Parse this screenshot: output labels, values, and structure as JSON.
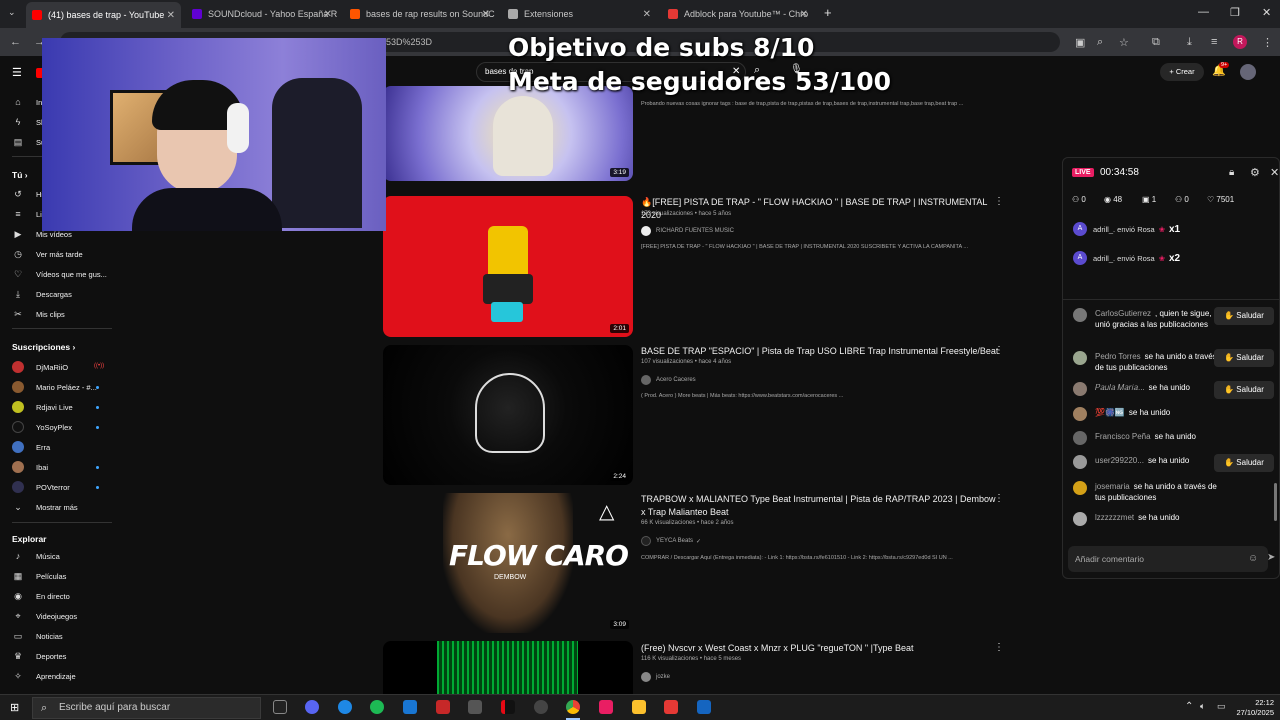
{
  "browser": {
    "tabs": [
      {
        "label": "(41) bases de trap - YouTube",
        "color": "#ff0000"
      },
      {
        "label": "SOUNDcloud - Yahoo España R",
        "color": "#6001d2"
      },
      {
        "label": "bases de rap results on SoundC",
        "color": "#ff5500"
      },
      {
        "label": "Extensiones",
        "color": "#aaaaaa"
      },
      {
        "label": "Adblock para Youtube™ - Chro",
        "color": "#e53935"
      }
    ],
    "url_fragment": "53D%253D",
    "profile_letter": "R"
  },
  "overlay": {
    "subs_goal": "Objetivo de subs 8/10",
    "followers_goal": "Meta de seguidores 53/100"
  },
  "youtube": {
    "search_value": "bases de trap",
    "create_label": "Crear",
    "notif_badge": "9+",
    "sidebar": {
      "you_heading": "Tú",
      "you_items": [
        {
          "icon": "history-icon",
          "label": "Historial"
        },
        {
          "icon": "playlist-icon",
          "label": "Listas"
        },
        {
          "icon": "video-icon",
          "label": "Mis vídeos"
        },
        {
          "icon": "clock-icon",
          "label": "Ver más tarde"
        },
        {
          "icon": "like-icon",
          "label": "Vídeos que me gus..."
        },
        {
          "icon": "download-icon",
          "label": "Descargas"
        },
        {
          "icon": "scissors-icon",
          "label": "Mis clips"
        }
      ],
      "subs_heading": "Suscripciones",
      "subscriptions": [
        {
          "label": "DjMaRiiO",
          "color": "#c03030",
          "live": true
        },
        {
          "label": "Mario Peláez - #...",
          "color": "#8a5a30",
          "dot": true
        },
        {
          "label": "Rdjavi Live",
          "color": "#c0c020",
          "dot": true
        },
        {
          "label": "YoSoyPlex",
          "color": "#111111",
          "dot": true
        },
        {
          "label": "Erra",
          "color": "#4070c0",
          "dot": false
        },
        {
          "label": "Ibai",
          "color": "#a07050",
          "dot": true
        },
        {
          "label": "POVterror",
          "color": "#303050",
          "dot": true
        }
      ],
      "show_more": "Mostrar más",
      "explore_heading": "Explorar",
      "explore_items": [
        {
          "icon": "music-icon",
          "label": "Música"
        },
        {
          "icon": "film-icon",
          "label": "Películas"
        },
        {
          "icon": "live-icon",
          "label": "En directo"
        },
        {
          "icon": "gamepad-icon",
          "label": "Videojuegos"
        },
        {
          "icon": "news-icon",
          "label": "Noticias"
        },
        {
          "icon": "trophy-icon",
          "label": "Deportes"
        },
        {
          "icon": "bulb-icon",
          "label": "Aprendizaje"
        }
      ]
    },
    "results": [
      {
        "duration": "3:19",
        "desc": "Probando nuevas cosas ignorar tags : base de trap,pista de trap,pistas de trap,bases de trap,instrumental trap,base trap,beat trap ..."
      },
      {
        "title": "🔥[FREE] PISTA DE TRAP - \" FLOW HACKIAO \" | BASE DE TRAP | INSTRUMENTAL 2020",
        "meta": "173 visualizaciones • hace 5 años",
        "channel": "RICHARD FUENTES MUSIC",
        "desc": "[FREE] PISTA DE TRAP - \" FLOW HACKIAO \" | BASE DE TRAP | INSTRUMENTAL 2020 SUSCRIBETE Y ACTIVA LA CAMPANITA ...",
        "duration": "2:01"
      },
      {
        "title": "BASE DE TRAP \"ESPACIO\" | Pista de Trap USO LIBRE Trap Instrumental Freestyle/Beat",
        "meta": "107 visualizaciones • hace 4 años",
        "channel": "Acero Caceres",
        "desc": "( Prod. Acero ) More beats | Más beats: https://www.beatstars.com/acerocaceres ...",
        "duration": "2:24"
      },
      {
        "title": "TRAPBOW x MALIANTEO Type Beat Instrumental | Pista de RAP/TRAP 2023 | Dembow x Trap Malianteo Beat",
        "meta": "66 K visualizaciones • hace 2 años",
        "channel": "YEYCA Beats",
        "desc": "COMPRAR / Descargar Aquí (Entrega inmediata): - Link 1: https://bsta.rs/fe6101510 - Link 2: https://bsta.rs/c9297ed0d SI UN ...",
        "duration": "3:09",
        "thumb_text": "FLOW CARO",
        "thumb_sub": "DEMBOW"
      },
      {
        "title": "(Free) Nvscvr x West Coast x Mnzr x PLUG \"regueTON \" |Type Beat",
        "meta": "116 K visualizaciones • hace 5 meses",
        "channel": "jozke"
      }
    ]
  },
  "live": {
    "badge": "LIVE",
    "timer": "00:34:58",
    "stats": {
      "a": "0",
      "b": "48",
      "c": "1",
      "d": "0",
      "likes": "7501"
    },
    "gifts": [
      {
        "text": "adrill_. envió Rosa",
        "count": "x1"
      },
      {
        "text": "adrill_. envió Rosa",
        "count": "x2"
      }
    ],
    "comments": [
      {
        "user": "CarlosGutierrez",
        "text": ", quien te sigue, se unió gracias a las publicaciones",
        "button": "Saludar"
      },
      {
        "user": "Pedro Torres",
        "text": "se ha unido a través de tus publicaciones",
        "button": "Saludar"
      },
      {
        "user": "𝑃𝑎𝑢𝑙𝑎 𝑀𝑎𝑟𝑖𝑎...",
        "text": "se ha unido",
        "button": "Saludar"
      },
      {
        "user": "💯🎆🆖",
        "text": "se ha unido",
        "button": ""
      },
      {
        "user": "Francisco Peña",
        "text": "se ha unido",
        "button": ""
      },
      {
        "user": "user299220...",
        "text": "se ha unido",
        "button": "Saludar"
      },
      {
        "user": "josemaria",
        "text": "se ha unido a través de tus publicaciones",
        "button": ""
      },
      {
        "user": "lzzzzzzmet",
        "text": "se ha unido",
        "button": ""
      }
    ],
    "comment_placeholder": "Añadir comentario"
  },
  "taskbar": {
    "search_placeholder": "Escribe aquí para buscar",
    "time": "22:12",
    "date": "27/10/2025"
  }
}
